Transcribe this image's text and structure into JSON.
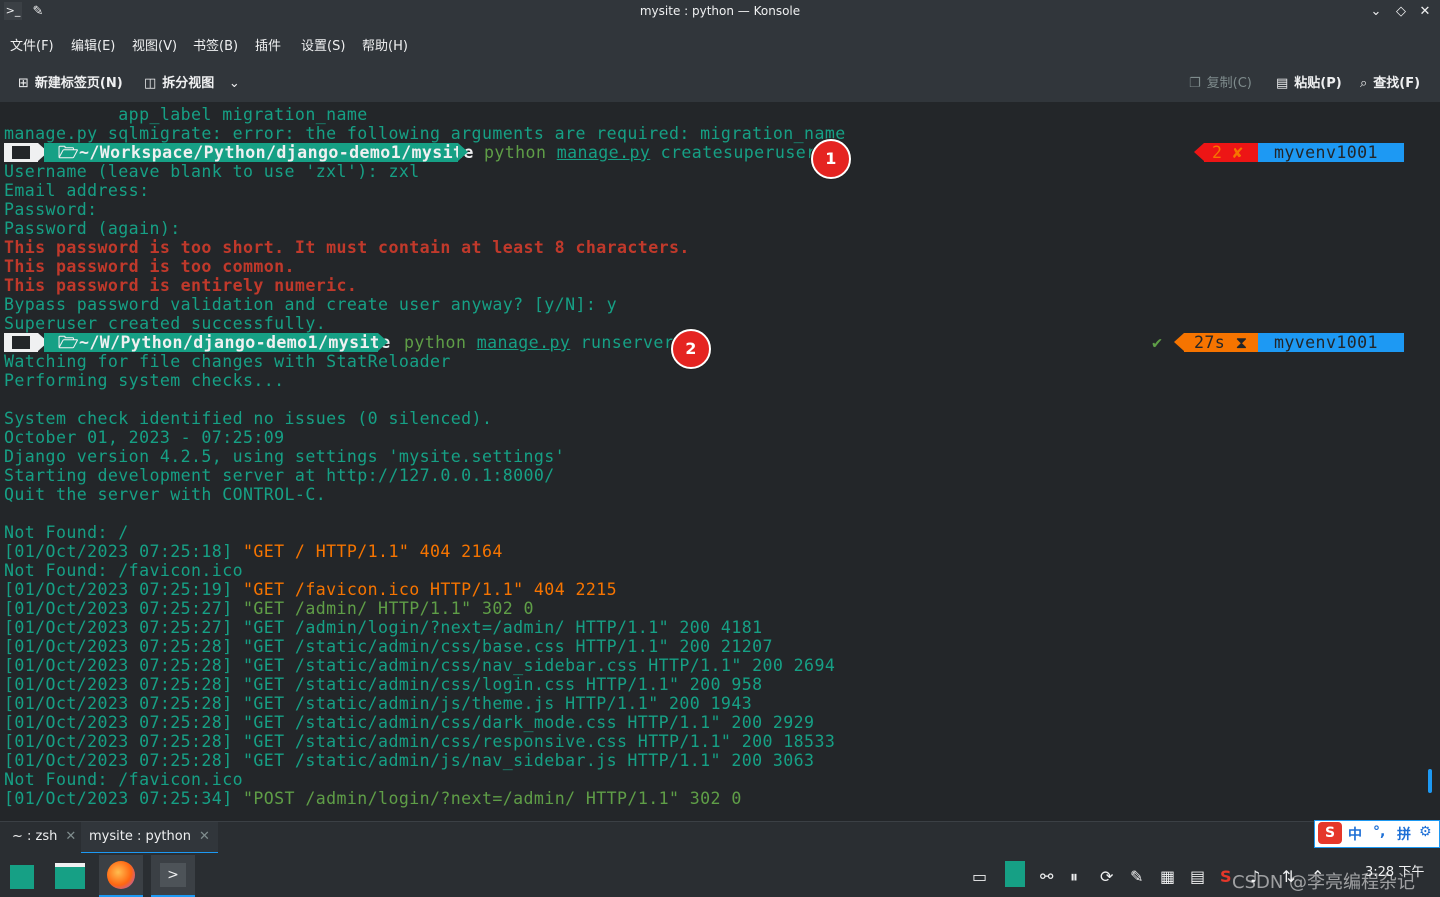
{
  "window": {
    "title": "mysite : python — Konsole"
  },
  "menu": [
    "文件(F)",
    "编辑(E)",
    "视图(V)",
    "书签(B)",
    "插件",
    "设置(S)",
    "帮助(H)"
  ],
  "toolbar": {
    "new_tab": "新建标签页(N)",
    "split_view": "拆分视图",
    "copy": "复制(C)",
    "paste": "粘贴(P)",
    "find": "查找(F)"
  },
  "terminal": {
    "l0": "           app_label migration_name",
    "l1": "manage.py sqlmigrate: error: the following arguments are required: migration_name",
    "prompt1": {
      "path": "~/Workspace/Python/django-demo1/mysite",
      "cmd_a": "python",
      "cmd_b": "manage.py",
      "cmd_c": "createsuperuser",
      "status": "2 ✘",
      "venv": "myvenv1001"
    },
    "l3": "Username (leave blank to use 'zxl'): zxl",
    "l4": "Email address:",
    "l5": "Password:",
    "l6": "Password (again):",
    "l7": "This password is too short. It must contain at least 8 characters.",
    "l8": "This password is too common.",
    "l9": "This password is entirely numeric.",
    "l10": "Bypass password validation and create user anyway? [y/N]: y",
    "l11": "Superuser created successfully.",
    "prompt2": {
      "path": "~/W/Python/django-demo1/mysite",
      "cmd_a": "python",
      "cmd_b": "manage.py",
      "cmd_c": "runserver",
      "check": "✔",
      "duration": "27s",
      "venv": "myvenv1001"
    },
    "l13": "Watching for file changes with StatReloader",
    "l14": "Performing system checks...",
    "l16": "System check identified no issues (0 silenced).",
    "l17": "October 01, 2023 - 07:25:09",
    "l18": "Django version 4.2.5, using settings 'mysite.settings'",
    "l19": "Starting development server at http://127.0.0.1:8000/",
    "l20": "Quit the server with CONTROL-C.",
    "l22": "Not Found: /",
    "l23a": "[01/Oct/2023 07:25:18] ",
    "l23b": "\"GET / HTTP/1.1\" 404 2164",
    "l24": "Not Found: /favicon.ico",
    "l25a": "[01/Oct/2023 07:25:19] ",
    "l25b": "\"GET /favicon.ico HTTP/1.1\" 404 2215",
    "l26a": "[01/Oct/2023 07:25:27] ",
    "l26b": "\"GET /admin/ HTTP/1.1\" 302 0",
    "l27": "[01/Oct/2023 07:25:27] \"GET /admin/login/?next=/admin/ HTTP/1.1\" 200 4181",
    "l28": "[01/Oct/2023 07:25:28] \"GET /static/admin/css/base.css HTTP/1.1\" 200 21207",
    "l29": "[01/Oct/2023 07:25:28] \"GET /static/admin/css/nav_sidebar.css HTTP/1.1\" 200 2694",
    "l30": "[01/Oct/2023 07:25:28] \"GET /static/admin/css/login.css HTTP/1.1\" 200 958",
    "l31": "[01/Oct/2023 07:25:28] \"GET /static/admin/js/theme.js HTTP/1.1\" 200 1943",
    "l32": "[01/Oct/2023 07:25:28] \"GET /static/admin/css/dark_mode.css HTTP/1.1\" 200 2929",
    "l33": "[01/Oct/2023 07:25:28] \"GET /static/admin/css/responsive.css HTTP/1.1\" 200 18533",
    "l34": "[01/Oct/2023 07:25:28] \"GET /static/admin/js/nav_sidebar.js HTTP/1.1\" 200 3063",
    "l35": "Not Found: /favicon.ico",
    "l36a": "[01/Oct/2023 07:25:34] ",
    "l36b": "\"POST /admin/login/?next=/admin/ HTTP/1.1\" 302 0"
  },
  "annotations": [
    "1",
    "2"
  ],
  "tabs": [
    {
      "label": "~ : zsh"
    },
    {
      "label": "mysite : python"
    }
  ],
  "ime": {
    "cn": "中",
    "punct": "°,",
    "pinyin": "拼"
  },
  "watermark": "CSDN @李亮编程杂记",
  "clock": "3:28 下午",
  "colors": {
    "teal": "#16a085",
    "blue": "#1d99f3",
    "red": "#ed1515",
    "orange": "#f67400"
  },
  "icons": [
    "konsole-icon",
    "pin-icon",
    "minimize-icon",
    "maximize-icon",
    "close-icon",
    "new-tab-icon",
    "split-view-icon",
    "copy-icon",
    "paste-icon",
    "search-icon",
    "folder-icon",
    "manjaro-icon",
    "file-manager-icon",
    "firefox-icon",
    "terminal-icon"
  ]
}
